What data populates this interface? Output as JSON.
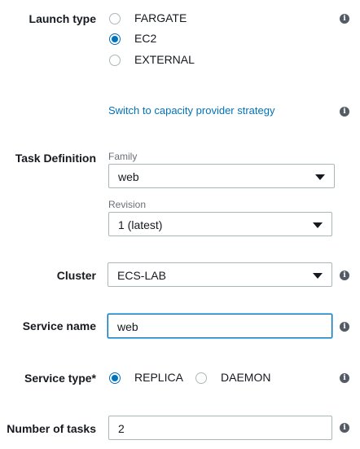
{
  "launch_type": {
    "label": "Launch type",
    "options": [
      {
        "label": "FARGATE",
        "selected": false
      },
      {
        "label": "EC2",
        "selected": true
      },
      {
        "label": "EXTERNAL",
        "selected": false
      }
    ]
  },
  "capacity_link": "Switch to capacity provider strategy",
  "task_definition": {
    "label": "Task Definition",
    "family_label": "Family",
    "family_value": "web",
    "revision_label": "Revision",
    "revision_value": "1 (latest)"
  },
  "cluster": {
    "label": "Cluster",
    "value": "ECS-LAB"
  },
  "service_name": {
    "label": "Service name",
    "value": "web"
  },
  "service_type": {
    "label": "Service type*",
    "options": [
      {
        "label": "REPLICA",
        "selected": true
      },
      {
        "label": "DAEMON",
        "selected": false
      }
    ]
  },
  "number_of_tasks": {
    "label": "Number of tasks",
    "value": "2"
  },
  "info_glyph": "i",
  "colors": {
    "accent": "#0073bb",
    "text": "#16191f",
    "muted": "#687078",
    "border": "#aab7b8",
    "info": "#545b64"
  },
  "icons": [
    "info-icon",
    "chevron-down-icon"
  ]
}
